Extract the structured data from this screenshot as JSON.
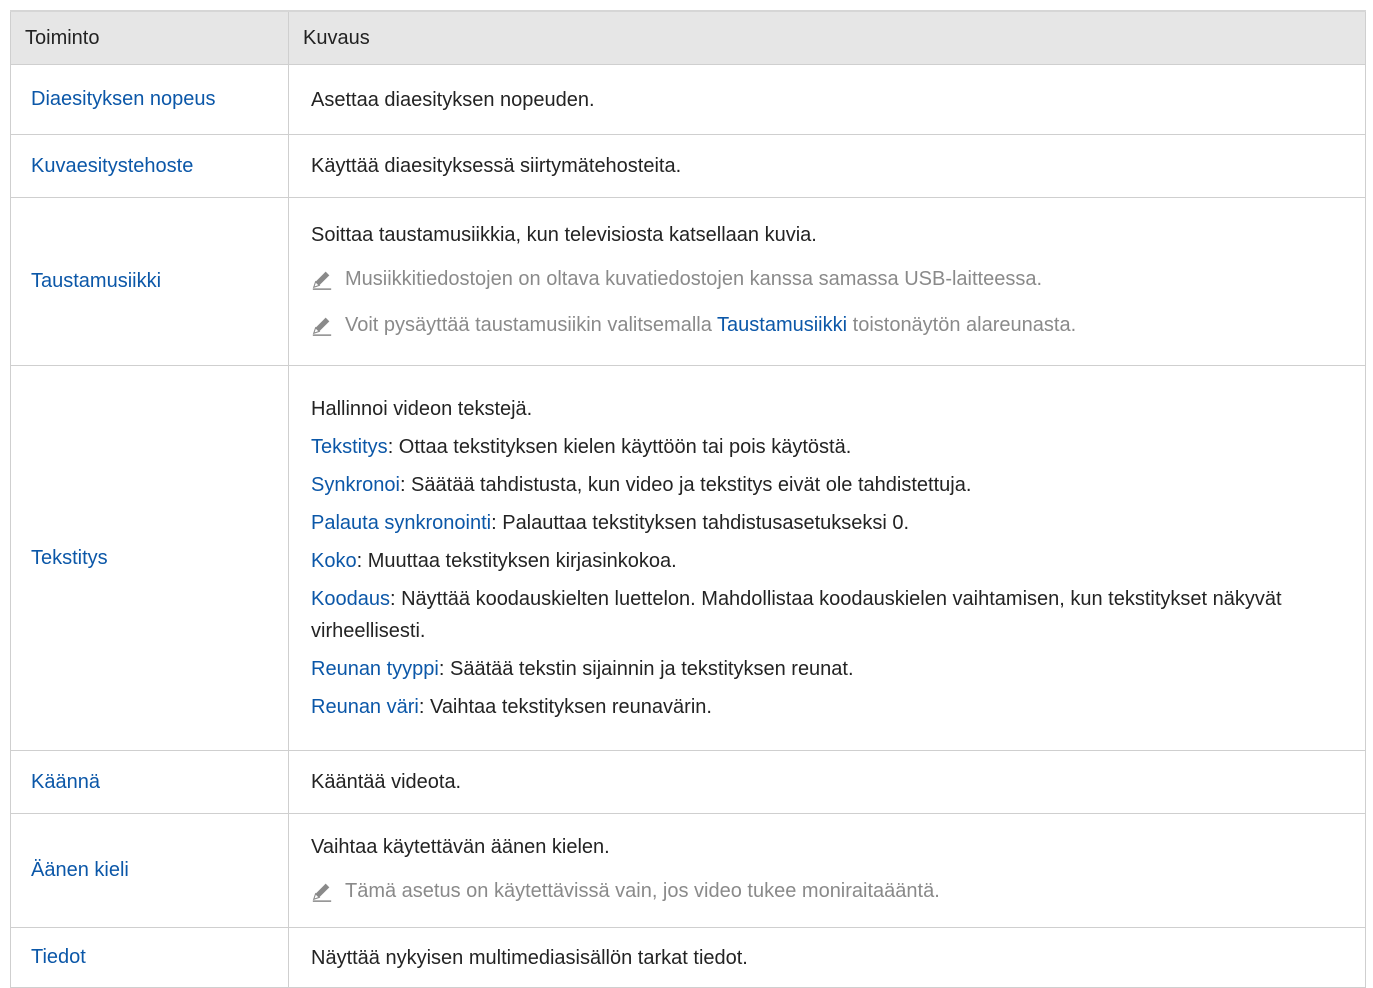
{
  "headers": {
    "function": "Toiminto",
    "description": "Kuvaus"
  },
  "rows": [
    {
      "name": "Diaesityksen nopeus",
      "desc": "Asettaa diaesityksen nopeuden."
    },
    {
      "name": "Kuvaesitystehoste",
      "desc": "Käyttää diaesityksessä siirtymätehosteita."
    },
    {
      "name": "Taustamusiikki",
      "desc": "Soittaa taustamusiikkia, kun televisiosta katsellaan kuvia.",
      "notes": [
        {
          "text": "Musiikkitiedostojen on oltava kuvatiedostojen kanssa samassa USB-laitteessa."
        },
        {
          "pre": "Voit pysäyttää taustamusiikin valitsemalla ",
          "kw": "Taustamusiikki",
          "post": " toistonäytön alareunasta."
        }
      ]
    },
    {
      "name": "Tekstitys",
      "desc": "Hallinnoi videon tekstejä.",
      "items": [
        {
          "kw": "Tekstitys",
          "text": ": Ottaa tekstityksen kielen käyttöön tai pois käytöstä."
        },
        {
          "kw": "Synkronoi",
          "text": ": Säätää tahdistusta, kun video ja tekstitys eivät ole tahdistettuja."
        },
        {
          "kw": "Palauta synkronointi",
          "text": ": Palauttaa tekstityksen tahdistusasetukseksi 0."
        },
        {
          "kw": "Koko",
          "text": ": Muuttaa tekstityksen kirjasinkokoa."
        },
        {
          "kw": "Koodaus",
          "text": ": Näyttää koodauskielten luettelon. Mahdollistaa koodauskielen vaihtamisen, kun tekstitykset näkyvät virheellisesti."
        },
        {
          "kw": "Reunan tyyppi",
          "text": ": Säätää tekstin sijainnin ja tekstityksen reunat."
        },
        {
          "kw": "Reunan väri",
          "text": ": Vaihtaa tekstityksen reunavärin."
        }
      ]
    },
    {
      "name": "Käännä",
      "desc": "Kääntää videota."
    },
    {
      "name": "Äänen kieli",
      "desc": "Vaihtaa käytettävän äänen kielen.",
      "notes": [
        {
          "text": "Tämä asetus on käytettävissä vain, jos video tukee moniraitaääntä."
        }
      ]
    },
    {
      "name": "Tiedot",
      "desc": "Näyttää nykyisen multimediasisällön tarkat tiedot."
    }
  ],
  "icons": {
    "note": "pencil-icon"
  },
  "colors": {
    "keyword": "#0b57a8",
    "note_text": "#8a8a8a",
    "header_bg": "#e6e6e6",
    "border": "#cfcfcf"
  }
}
